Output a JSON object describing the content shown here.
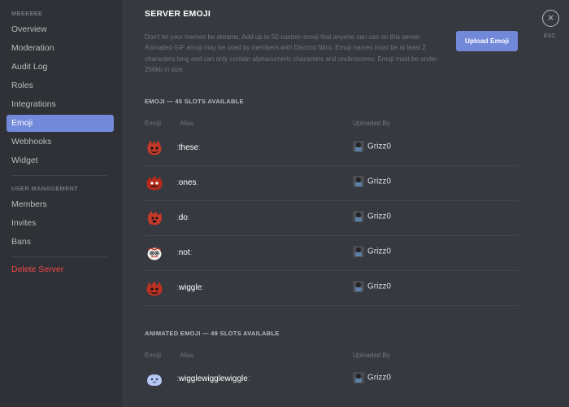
{
  "sidebar": {
    "server_section": "MEEEEEE",
    "items": [
      {
        "label": "Overview"
      },
      {
        "label": "Moderation"
      },
      {
        "label": "Audit Log"
      },
      {
        "label": "Roles"
      },
      {
        "label": "Integrations"
      },
      {
        "label": "Emoji"
      },
      {
        "label": "Webhooks"
      },
      {
        "label": "Widget"
      }
    ],
    "user_section": "USER MANAGEMENT",
    "user_items": [
      {
        "label": "Members"
      },
      {
        "label": "Invites"
      },
      {
        "label": "Bans"
      }
    ],
    "delete_label": "Delete Server",
    "active_item": "Emoji"
  },
  "main": {
    "title": "SERVER EMOJI",
    "description": "Don't let your memes be dreams. Add up to 50 custom emoji that anyone can use on this server. Animated GIF emoji may be used by members with Discord Nitro. Emoji names must be at least 2 characters long and can only contain alphanumeric characters and underscores. Emoji must be under 256kb in size.",
    "upload_label": "Upload Emoji",
    "close_label": "ESC",
    "close_glyph": "×",
    "static_section": "EMOJI — 45 SLOTS AVAILABLE",
    "animated_section": "ANIMATED EMOJI — 49 SLOTS AVAILABLE",
    "columns": {
      "emoji": "Emoji",
      "alias": "Alias",
      "uploaded_by": "Uploaded By"
    },
    "emojis": [
      {
        "alias": "these",
        "uploader": "Grizz0"
      },
      {
        "alias": "ones",
        "uploader": "Grizz0"
      },
      {
        "alias": "do",
        "uploader": "Grizz0"
      },
      {
        "alias": "not",
        "uploader": "Grizz0"
      },
      {
        "alias": "wiggle",
        "uploader": "Grizz0"
      }
    ],
    "animated_emojis": [
      {
        "alias": "wigglewigglewiggle",
        "uploader": "Grizz0"
      }
    ]
  },
  "colors": {
    "accent": "#7289da",
    "danger": "#f04747",
    "sidebar_bg": "#2f3136",
    "main_bg": "#36393f"
  }
}
